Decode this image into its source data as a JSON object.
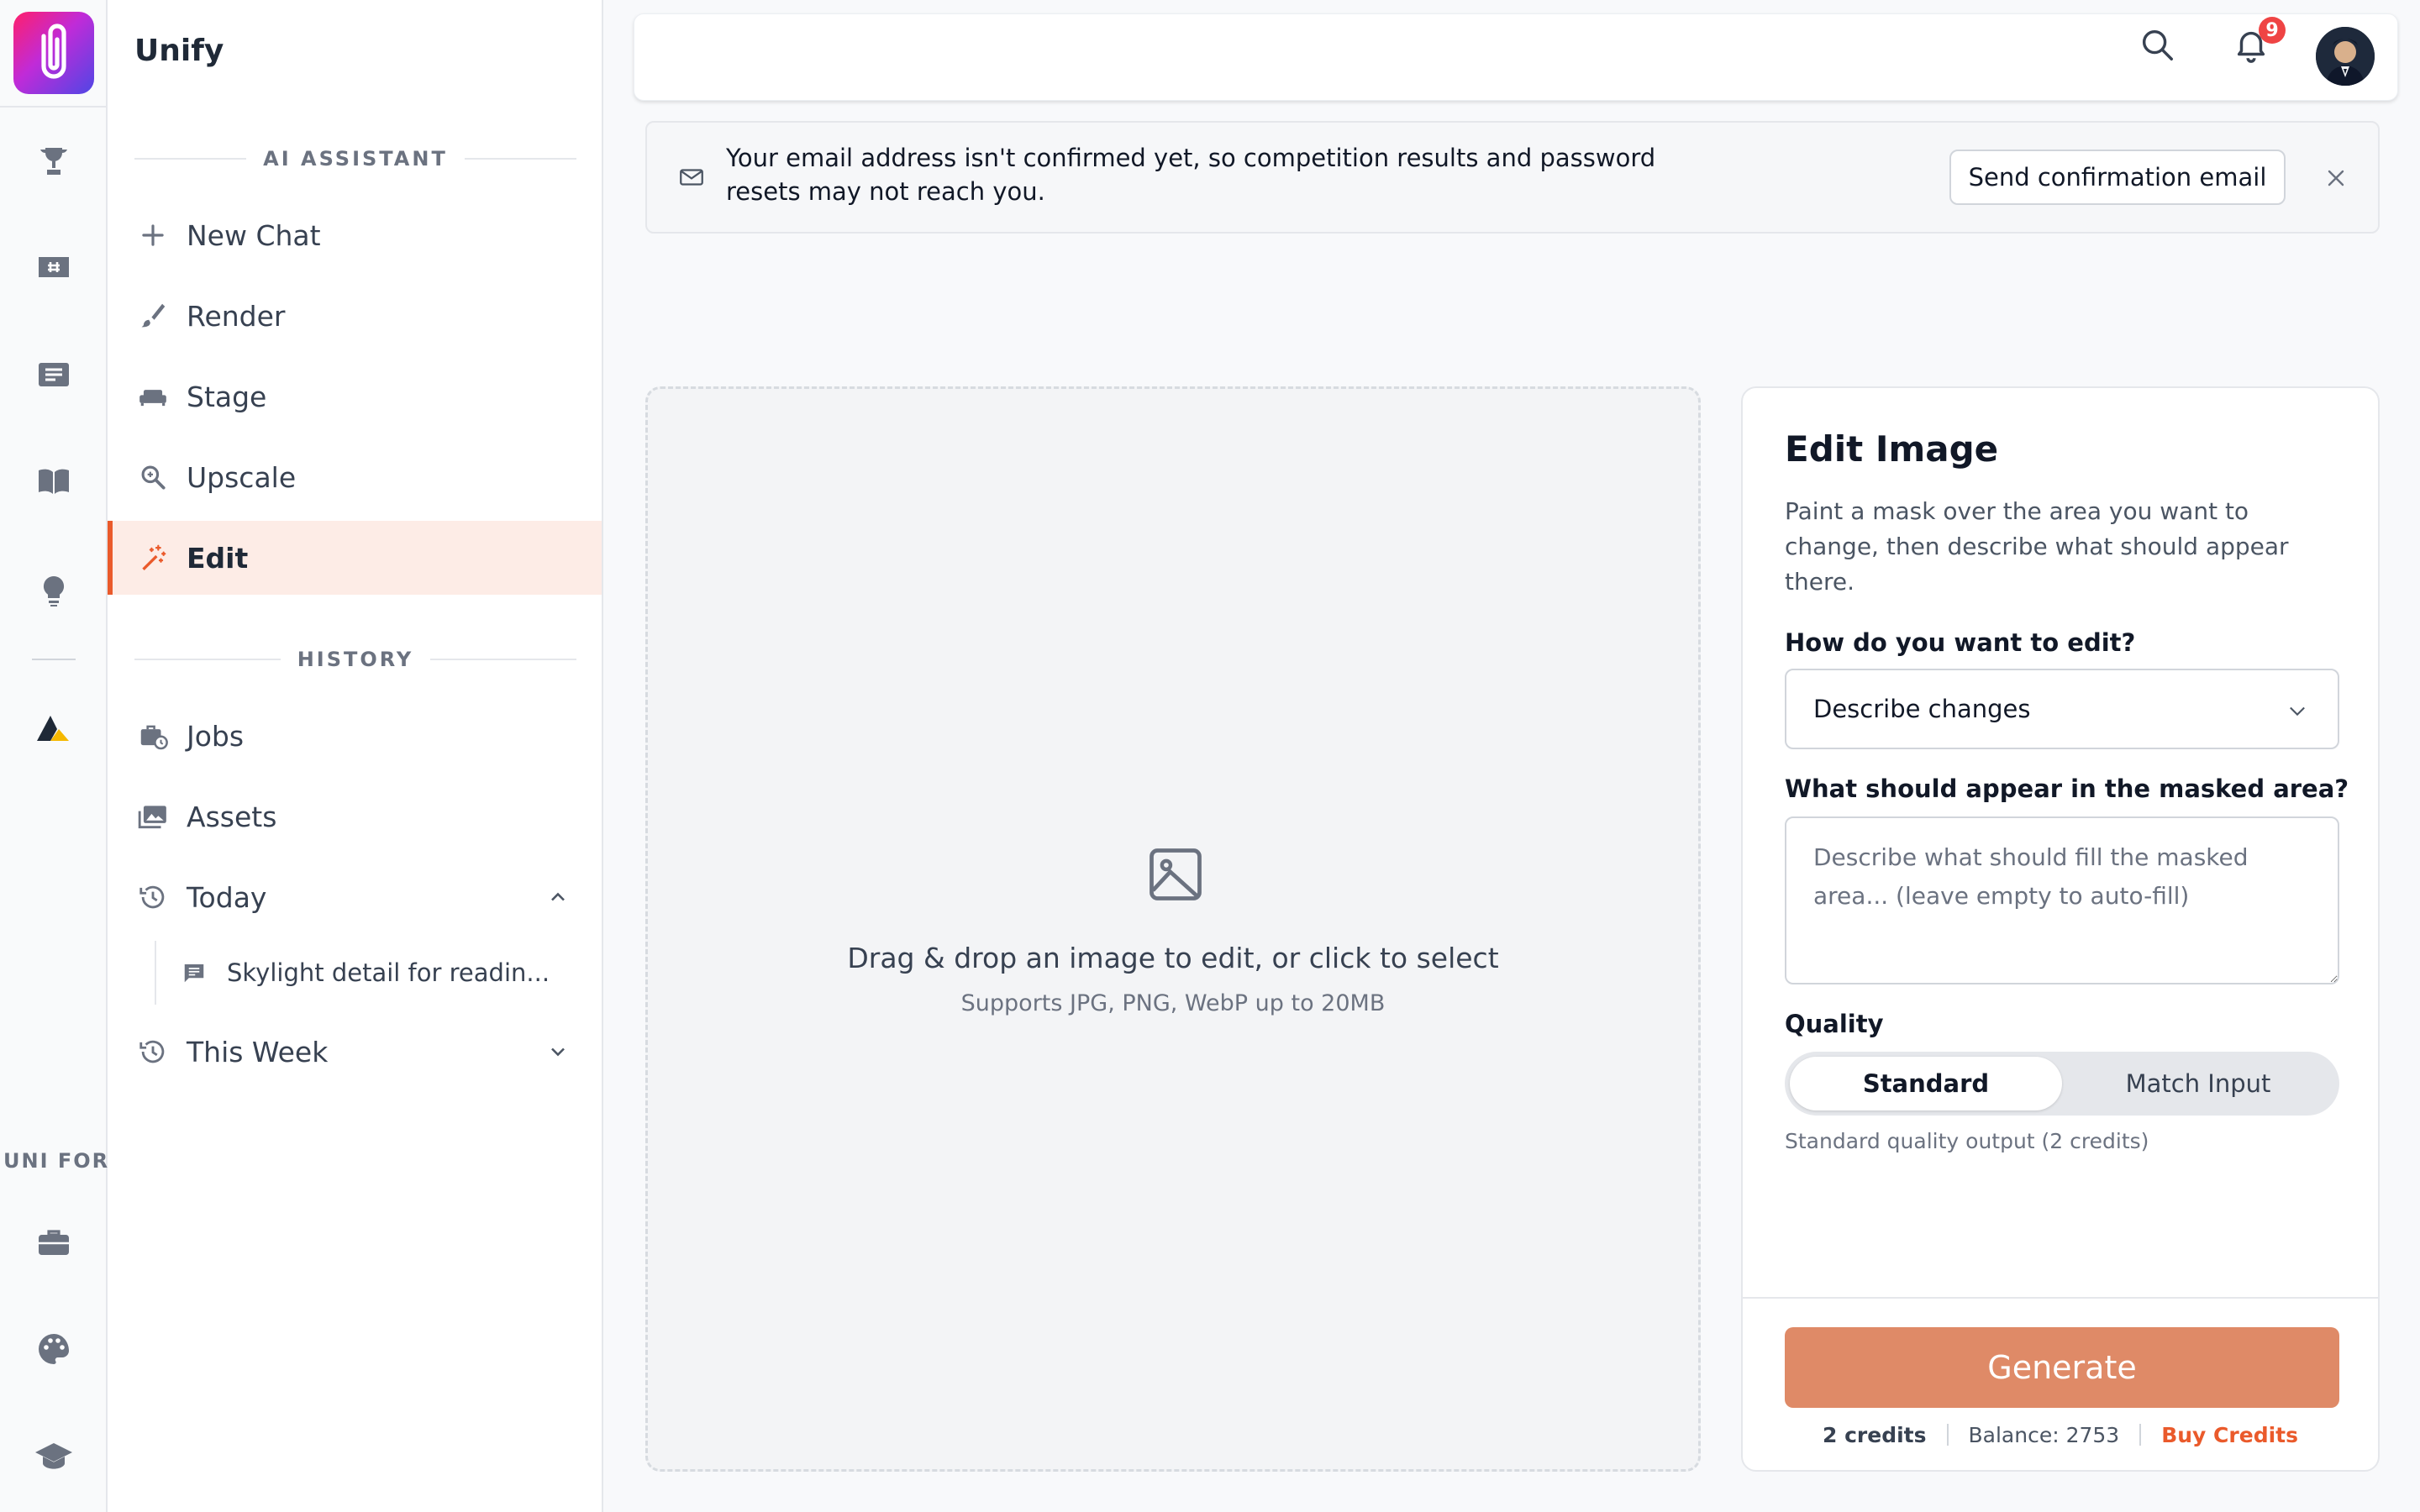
{
  "app": {
    "title": "Unify"
  },
  "rail": {
    "section_label": "UNI FOR"
  },
  "sidebar": {
    "ai_section": "AI ASSISTANT",
    "ai_items": [
      {
        "label": "New Chat",
        "icon": "plus-icon"
      },
      {
        "label": "Render",
        "icon": "brush-icon"
      },
      {
        "label": "Stage",
        "icon": "sofa-icon"
      },
      {
        "label": "Upscale",
        "icon": "zoom-icon"
      },
      {
        "label": "Edit",
        "icon": "magic-wand-icon",
        "active": true
      }
    ],
    "history_section": "HISTORY",
    "history_items": [
      {
        "label": "Jobs",
        "icon": "briefcase-clock-icon"
      },
      {
        "label": "Assets",
        "icon": "images-icon"
      },
      {
        "label": "Today",
        "icon": "history-icon",
        "expanded": true
      },
      {
        "label": "This Week",
        "icon": "history-icon",
        "expanded": false
      }
    ],
    "today_chats": [
      {
        "label": "Skylight detail for readin..."
      }
    ]
  },
  "topbar": {
    "notification_count": "9"
  },
  "banner": {
    "message": "Your email address isn't confirmed yet, so competition results and password resets may not reach you.",
    "button": "Send confirmation email"
  },
  "dropzone": {
    "title": "Drag & drop an image to edit, or click to select",
    "subtitle": "Supports JPG, PNG, WebP up to 20MB"
  },
  "edit_panel": {
    "title": "Edit Image",
    "description": "Paint a mask over the area you want to change, then describe what should appear there.",
    "mode_label": "How do you want to edit?",
    "mode_value": "Describe changes",
    "prompt_label": "What should appear in the masked area?",
    "prompt_placeholder": "Describe what should fill the masked area... (leave empty to auto-fill)",
    "quality_label": "Quality",
    "quality_options": [
      "Standard",
      "Match Input"
    ],
    "quality_selected": "Standard",
    "quality_hint": "Standard quality output (2 credits)",
    "generate": "Generate",
    "cost": "2 credits",
    "balance": "Balance: 2753",
    "buy": "Buy Credits"
  },
  "colors": {
    "accent": "#ea5a2b",
    "generate_bg": "#df8a67",
    "active_bg": "#fdece6",
    "badge": "#ef4444"
  }
}
